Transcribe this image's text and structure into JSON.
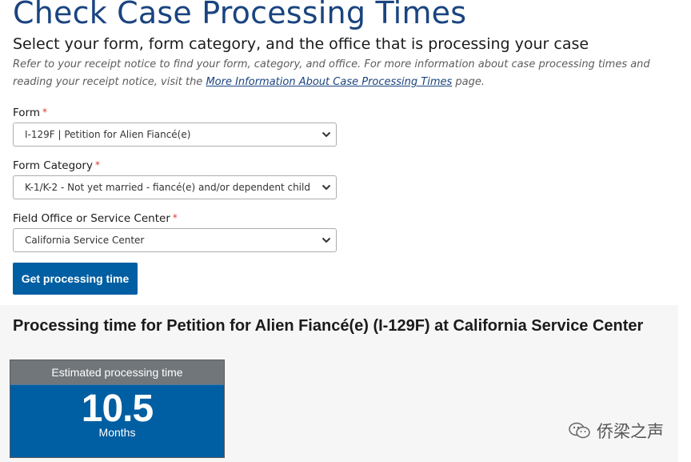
{
  "header": {
    "title": "Check Case Processing Times",
    "subtitle": "Select your form, form category, and the office that is processing your case",
    "intro_before": "Refer to your receipt notice to find your form, category, and office. For more information about case processing times and reading your receipt notice, visit the ",
    "intro_link": "More Information About Case Processing Times",
    "intro_after": " page."
  },
  "form": {
    "form_label": "Form",
    "form_value": "I-129F | Petition for Alien Fiancé(e)",
    "category_label": "Form Category",
    "category_value": "K-1/K-2 - Not yet married - fiancé(e) and/or dependent child",
    "office_label": "Field Office or Service Center",
    "office_value": "California Service Center",
    "required_mark": "*",
    "submit_label": "Get processing time"
  },
  "results": {
    "title": "Processing time for Petition for Alien Fiancé(e) (I-129F) at California Service Center",
    "card_header": "Estimated processing time",
    "value": "10.5",
    "unit": "Months"
  },
  "watermark": {
    "text": "侨梁之声"
  },
  "colors": {
    "title_blue": "#1a4480",
    "button_blue": "#005ea2",
    "required_red": "#d83933",
    "card_header_gray": "#71767a"
  }
}
